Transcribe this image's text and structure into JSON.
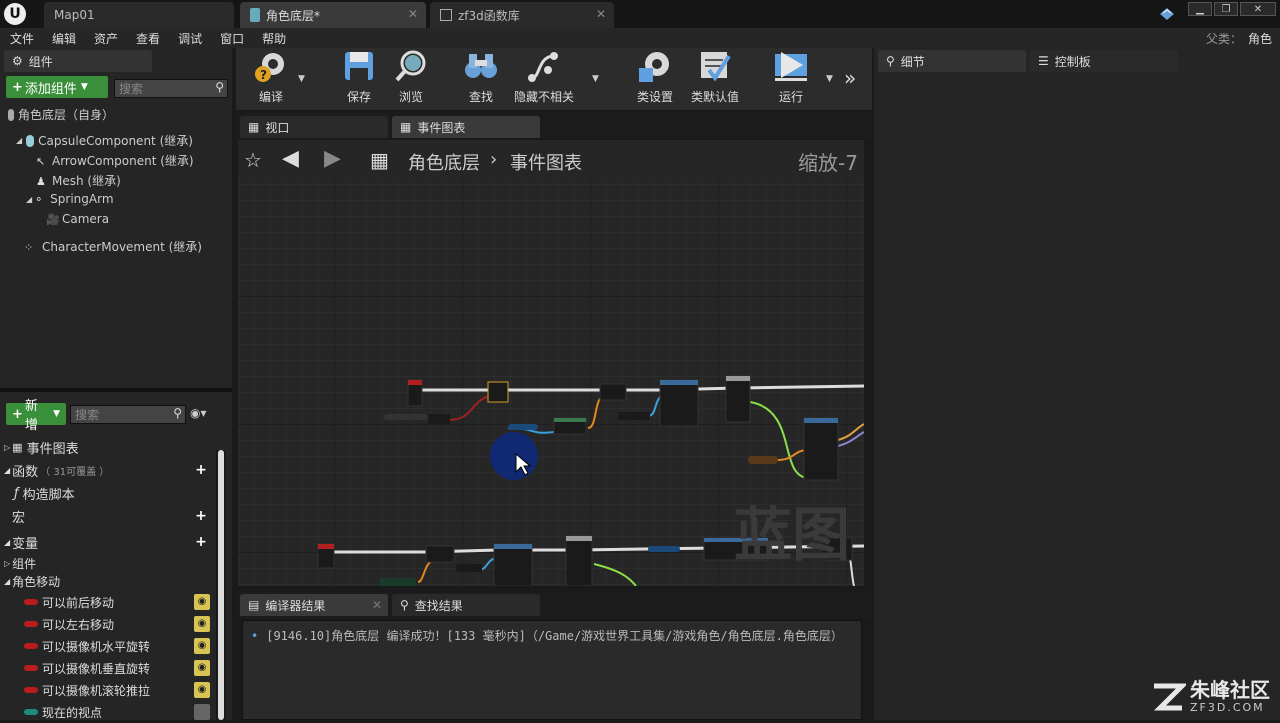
{
  "titlebar": {
    "tabs": [
      {
        "label": "Map01"
      },
      {
        "label": "角色底层*"
      },
      {
        "label": "zf3d函数库"
      }
    ]
  },
  "menu": {
    "items": [
      "文件",
      "编辑",
      "资产",
      "查看",
      "调试",
      "窗口",
      "帮助"
    ],
    "parent_label": "父类：",
    "parent_value": "角色"
  },
  "components_panel": {
    "tab": "组件",
    "add_button": "添加组件",
    "search_placeholder": "搜索",
    "self": "角色底层（自身）",
    "tree": [
      "CapsuleComponent (继承)",
      "ArrowComponent (继承)",
      "Mesh (继承)",
      "SpringArm",
      "Camera",
      "CharacterMovement (继承)"
    ]
  },
  "my_blueprint": {
    "new_button": "新增",
    "search_placeholder": "搜索",
    "event_graph": "事件图表",
    "functions": "函数",
    "functions_note": "（ 31可覆盖 ）",
    "construction_script": "构造脚本",
    "macros": "宏",
    "variables": "变量",
    "components": "组件",
    "category": "角色移动",
    "vars": [
      "可以前后移动",
      "可以左右移动",
      "可以摄像机水平旋转",
      "可以摄像机垂直旋转",
      "可以摄像机滚轮推拉",
      "现在的视点"
    ]
  },
  "toolbar": {
    "compile": "编译",
    "save": "保存",
    "browse": "浏览",
    "find": "查找",
    "hide_unrelated": "隐藏不相关",
    "class_settings": "类设置",
    "class_defaults": "类默认值",
    "run": "运行"
  },
  "graph_tabs": [
    "视口",
    "事件图表"
  ],
  "graph": {
    "breadcrumb_root": "角色底层",
    "breadcrumb_leaf": "事件图表",
    "zoom": "缩放-7",
    "watermark": "蓝图"
  },
  "bottom_tabs": [
    "编译器结果",
    "查找结果"
  ],
  "log": {
    "line": "[9146.10]角色底层 编译成功！[133 毫秒内]（/Game/游戏世界工具集/游戏角色/角色底层.角色底层）"
  },
  "details": {
    "tab1": "细节",
    "tab2": "控制板"
  },
  "brand": {
    "name": "朱峰社区",
    "site": "ZF3D.COM"
  },
  "colors": {
    "accent_green": "#3a8f3a",
    "var_red": "#b91d1d",
    "var_teal": "#1e8a82"
  }
}
